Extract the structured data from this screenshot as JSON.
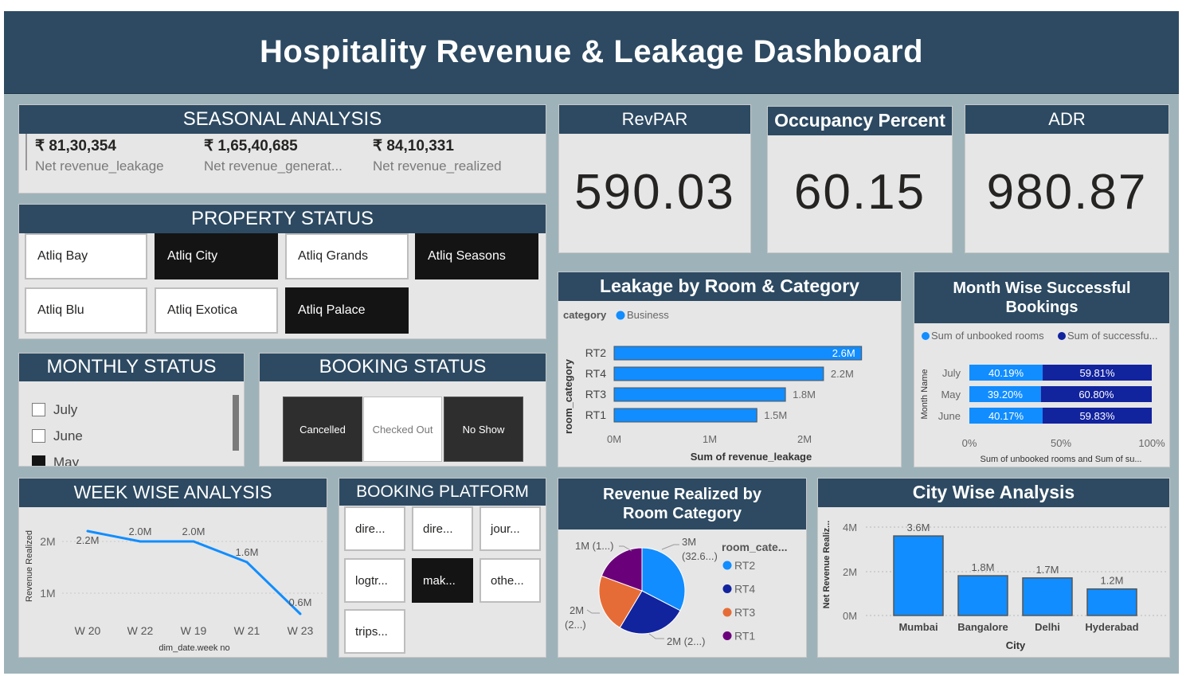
{
  "title": "Hospitality Revenue & Leakage Dashboard",
  "colors": {
    "header": "#2d4a62",
    "canvas": "#9eb3b9",
    "card": "#e6e6e6",
    "bar_blue": "#118dff",
    "dark_blue": "#12239e",
    "orange": "#e66c37",
    "purple": "#6b007b"
  },
  "seasonal": {
    "heading": "SEASONAL ANALYSIS",
    "kpis": [
      {
        "value": "₹ 81,30,354",
        "label": "Net revenue_leakage"
      },
      {
        "value": "₹ 1,65,40,685",
        "label": "Net revenue_generat..."
      },
      {
        "value": "₹ 84,10,331",
        "label": "Net revenue_realized"
      }
    ]
  },
  "revpar": {
    "heading": "RevPAR",
    "value": "590.03"
  },
  "occupancy": {
    "heading": "Occupancy Percent",
    "value": "60.15"
  },
  "adr": {
    "heading": "ADR",
    "value": "980.87"
  },
  "property_status": {
    "heading": "PROPERTY STATUS",
    "items": [
      {
        "label": "Atliq Bay",
        "selected": false
      },
      {
        "label": "Atliq City",
        "selected": true
      },
      {
        "label": "Atliq Grands",
        "selected": false
      },
      {
        "label": "Atliq Seasons",
        "selected": true
      },
      {
        "label": "Atliq Blu",
        "selected": false
      },
      {
        "label": "Atliq Exotica",
        "selected": false
      },
      {
        "label": "Atliq Palace",
        "selected": true
      }
    ]
  },
  "monthly_status": {
    "heading": "MONTHLY STATUS",
    "items": [
      {
        "label": "July",
        "checked": false
      },
      {
        "label": "June",
        "checked": false
      },
      {
        "label": "May",
        "checked": true
      }
    ]
  },
  "booking_status": {
    "heading": "BOOKING STATUS",
    "items": [
      {
        "label": "Cancelled",
        "selected": true
      },
      {
        "label": "Checked Out",
        "selected": false
      },
      {
        "label": "No Show",
        "selected": true
      }
    ]
  },
  "leakage_chart": {
    "heading": "Leakage by Room & Category",
    "legend_title": "category",
    "legend_item": "Business",
    "ylabel": "room_category",
    "xlabel": "Sum of revenue_leakage",
    "x_ticks": [
      "0M",
      "1M",
      "2M"
    ]
  },
  "month_chart": {
    "heading": "Month Wise Successful Bookings",
    "legend": [
      "Sum of unbooked rooms",
      "Sum of successfu..."
    ],
    "ylabel": "Month Name",
    "xlabel": "Sum of unbooked rooms and Sum of su...",
    "x_ticks": [
      "0%",
      "50%",
      "100%"
    ]
  },
  "week_chart": {
    "heading": "WEEK WISE ANALYSIS",
    "ylabel": "Revenue Realized",
    "xlabel": "dim_date.week no",
    "y_ticks": [
      "2M",
      "1M"
    ]
  },
  "platform": {
    "heading": "BOOKING PLATFORM",
    "items": [
      {
        "label": "dire...",
        "selected": false
      },
      {
        "label": "dire...",
        "selected": false
      },
      {
        "label": "jour...",
        "selected": false
      },
      {
        "label": "logtr...",
        "selected": false
      },
      {
        "label": "mak...",
        "selected": true
      },
      {
        "label": "othe...",
        "selected": false
      },
      {
        "label": "trips...",
        "selected": false
      }
    ]
  },
  "pie_chart": {
    "heading": "Revenue Realized by Room Category",
    "legend_title": "room_cate...",
    "callouts": [
      "3M",
      "(32.6...)",
      "2M (2...)",
      "2M",
      "(2...)",
      "1M (1...)"
    ]
  },
  "city_chart": {
    "heading": "City Wise Analysis",
    "ylabel": "Net Revenue Realiz...",
    "xlabel": "City",
    "y_ticks": [
      "4M",
      "2M",
      "0M"
    ]
  },
  "chart_data": [
    {
      "type": "bar",
      "title": "Leakage by Room & Category",
      "orientation": "horizontal",
      "categories": [
        "RT2",
        "RT4",
        "RT3",
        "RT1"
      ],
      "values": [
        2.6,
        2.2,
        1.8,
        1.5
      ],
      "value_labels": [
        "2.6M",
        "2.2M",
        "1.8M",
        "1.5M"
      ],
      "units": "M",
      "xlim": [
        0,
        2.6
      ],
      "series": [
        {
          "name": "Business",
          "values": [
            2.6,
            2.2,
            1.8,
            1.5
          ]
        }
      ],
      "xlabel": "Sum of revenue_leakage",
      "ylabel": "room_category"
    },
    {
      "type": "bar",
      "title": "Month Wise Successful Bookings",
      "stacked": "100%",
      "orientation": "horizontal",
      "categories": [
        "July",
        "May",
        "June"
      ],
      "series": [
        {
          "name": "Sum of unbooked rooms",
          "values": [
            40.19,
            39.2,
            40.17
          ],
          "labels": [
            "40.19%",
            "39.20%",
            "40.17%"
          ]
        },
        {
          "name": "Sum of successfu...",
          "values": [
            59.81,
            60.8,
            59.83
          ],
          "labels": [
            "59.81%",
            "60.80%",
            "59.83%"
          ]
        }
      ],
      "xlabel": "Sum of unbooked rooms and Sum of su...",
      "ylabel": "Month Name"
    },
    {
      "type": "line",
      "title": "WEEK WISE ANALYSIS",
      "x": [
        "W 20",
        "W 22",
        "W 19",
        "W 21",
        "W 23"
      ],
      "values": [
        2.2,
        2.0,
        2.0,
        1.6,
        0.6
      ],
      "value_labels": [
        "2.2M",
        "2.0M",
        "2.0M",
        "1.6M",
        "0.6M"
      ],
      "units": "M",
      "ylim": [
        0.5,
        2.3
      ],
      "xlabel": "dim_date.week no",
      "ylabel": "Revenue Realized"
    },
    {
      "type": "pie",
      "title": "Revenue Realized by Room Category",
      "labels": [
        "RT2",
        "RT4",
        "RT3",
        "RT1"
      ],
      "values": [
        32.6,
        26.0,
        22.0,
        19.4
      ],
      "colors": [
        "#118dff",
        "#12239e",
        "#e66c37",
        "#6b007b"
      ]
    },
    {
      "type": "bar",
      "title": "City Wise Analysis",
      "categories": [
        "Mumbai",
        "Bangalore",
        "Delhi",
        "Hyderabad"
      ],
      "values": [
        3.6,
        1.8,
        1.7,
        1.2
      ],
      "value_labels": [
        "3.6M",
        "1.8M",
        "1.7M",
        "1.2M"
      ],
      "units": "M",
      "ylim": [
        0,
        4
      ],
      "xlabel": "City",
      "ylabel": "Net Revenue Realiz..."
    }
  ]
}
